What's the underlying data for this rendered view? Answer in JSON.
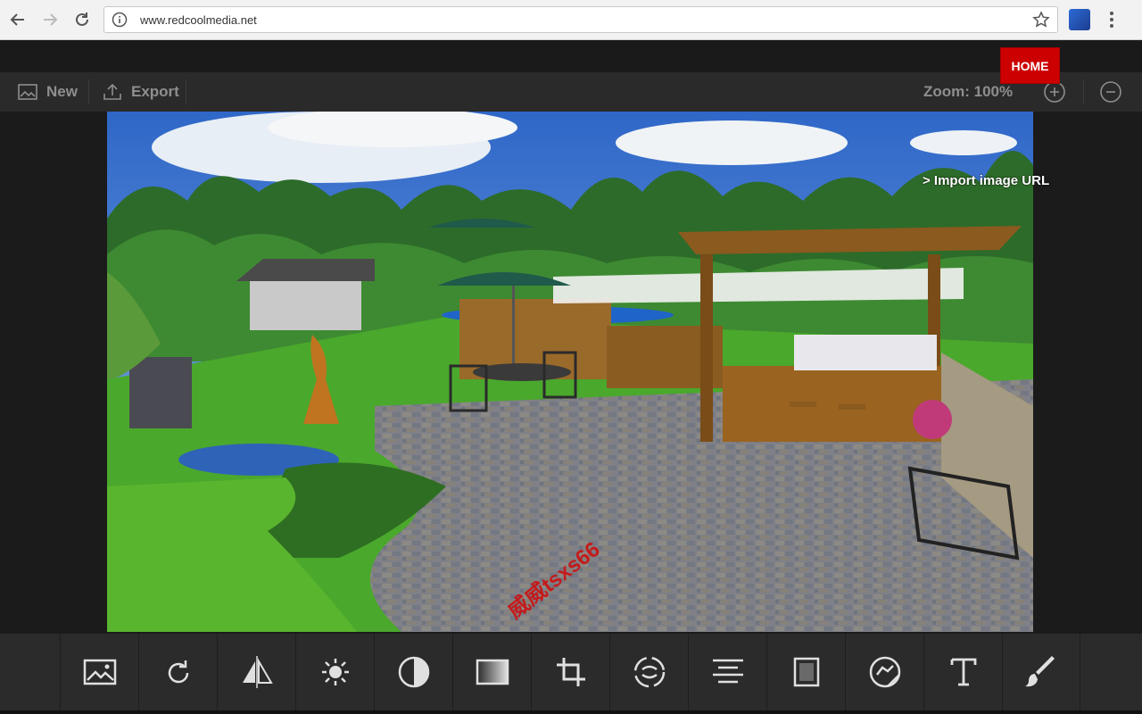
{
  "browser": {
    "url": "www.redcoolmedia.net"
  },
  "toolbar": {
    "new_label": "New",
    "export_label": "Export",
    "zoom_label": "Zoom: 100%"
  },
  "home_label": "HOME",
  "import_link": "> Import image URL",
  "watermark": "威威tsxs66",
  "bottom_tools": [
    {
      "name": "image-icon"
    },
    {
      "name": "rotate-icon"
    },
    {
      "name": "flip-icon"
    },
    {
      "name": "brightness-icon"
    },
    {
      "name": "contrast-icon"
    },
    {
      "name": "gradient-icon"
    },
    {
      "name": "crop-icon"
    },
    {
      "name": "focus-icon"
    },
    {
      "name": "align-icon"
    },
    {
      "name": "frame-icon"
    },
    {
      "name": "sticker-icon"
    },
    {
      "name": "text-icon"
    },
    {
      "name": "brush-icon"
    }
  ],
  "colors": {
    "accent": "#cc0000",
    "toolbar_bg": "#2a2a2a",
    "icon": "#e0e0e0"
  }
}
